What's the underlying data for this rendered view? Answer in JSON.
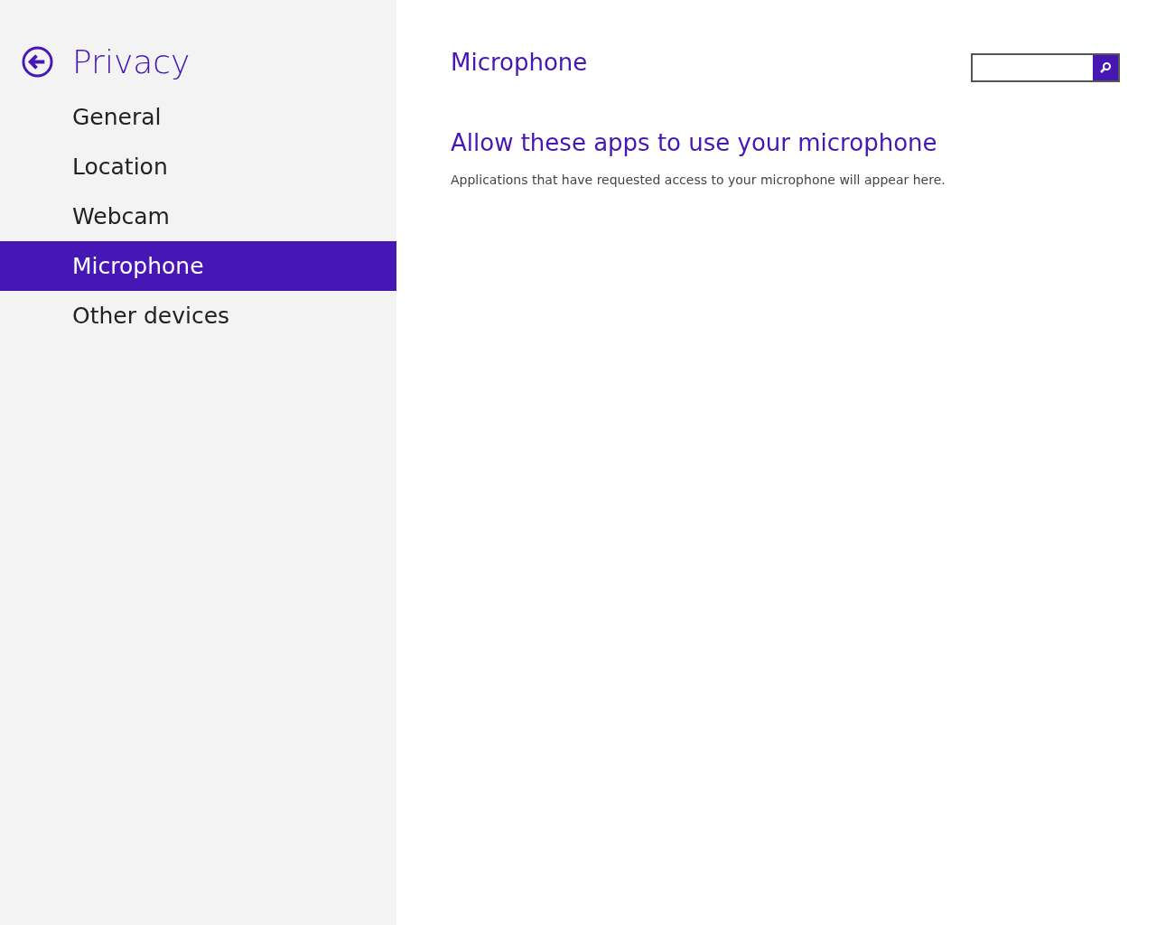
{
  "sidebar": {
    "title": "Privacy",
    "items": [
      {
        "label": "General",
        "selected": false
      },
      {
        "label": "Location",
        "selected": false
      },
      {
        "label": "Webcam",
        "selected": false
      },
      {
        "label": "Microphone",
        "selected": true
      },
      {
        "label": "Other devices",
        "selected": false
      }
    ]
  },
  "page": {
    "title": "Microphone",
    "section_heading": "Allow these apps to use your microphone",
    "description": "Applications that have requested access to your microphone will appear here."
  }
}
